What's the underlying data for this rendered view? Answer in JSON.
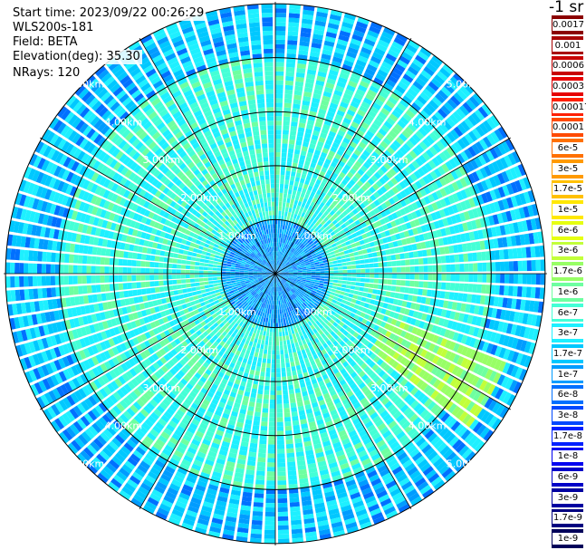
{
  "header": {
    "start_time": "Start time: 2023/09/22 00:26:29",
    "instrument": "WLS200s-181",
    "field": "Field: BETA",
    "elevation": "Elevation(deg): 35.30",
    "nrays": "NRays: 120"
  },
  "colorbar": {
    "unit_label": "-1 sr",
    "levels": [
      {
        "label": "0.0017",
        "color": "#8b0000"
      },
      {
        "label": "0.001",
        "color": "#a80000"
      },
      {
        "label": "0.0006",
        "color": "#c80000"
      },
      {
        "label": "0.0003",
        "color": "#e60000"
      },
      {
        "label": "0.00017",
        "color": "#ff2000"
      },
      {
        "label": "0.0001",
        "color": "#ff4a00"
      },
      {
        "label": "6e-5",
        "color": "#ff7000"
      },
      {
        "label": "3e-5",
        "color": "#ff9a00"
      },
      {
        "label": "1.7e-5",
        "color": "#ffc000"
      },
      {
        "label": "1e-5",
        "color": "#ffe800"
      },
      {
        "label": "6e-6",
        "color": "#e6ff10"
      },
      {
        "label": "3e-6",
        "color": "#c2ff3a"
      },
      {
        "label": "1.7e-6",
        "color": "#98ff66"
      },
      {
        "label": "1e-6",
        "color": "#6effa0"
      },
      {
        "label": "6e-7",
        "color": "#44ffd6"
      },
      {
        "label": "3e-7",
        "color": "#1ef0ff"
      },
      {
        "label": "1.7e-7",
        "color": "#00c8ff"
      },
      {
        "label": "1e-7",
        "color": "#009cff"
      },
      {
        "label": "6e-8",
        "color": "#0070ff"
      },
      {
        "label": "3e-8",
        "color": "#0048ff"
      },
      {
        "label": "1.7e-8",
        "color": "#0020ff"
      },
      {
        "label": "1e-8",
        "color": "#0000f0"
      },
      {
        "label": "6e-9",
        "color": "#0000c8"
      },
      {
        "label": "3e-9",
        "color": "#0000a0"
      },
      {
        "label": "1.7e-9",
        "color": "#000080"
      },
      {
        "label": "1e-9",
        "color": "#00005a"
      }
    ]
  },
  "chart_data": {
    "type": "heatmap",
    "projection": "polar PPI scan",
    "field": "BETA",
    "elevation_deg": 35.3,
    "nrays": 120,
    "range_rings_km": [
      1,
      2,
      3,
      4,
      5
    ],
    "ring_labels": [
      "1.00km",
      "2.00km",
      "3.00km",
      "4.00km",
      "5.00km"
    ],
    "azimuth_spokes_deg": [
      0,
      30,
      60,
      90,
      120,
      150,
      180,
      210,
      240,
      270,
      300,
      330
    ],
    "dominant_values": {
      "inner_0_to_1km": "1e-7 to 1.7e-7",
      "middle_1_to_4km": "3e-7 to 6e-7",
      "outer_4_to_5km": "1e-7 to 3e-7 with scattered 6e-8"
    },
    "enhanced_region": {
      "azimuth_deg": [
        110,
        130
      ],
      "range_km": [
        2.2,
        4.5
      ],
      "value": "1.7e-6 to 3e-6"
    }
  }
}
